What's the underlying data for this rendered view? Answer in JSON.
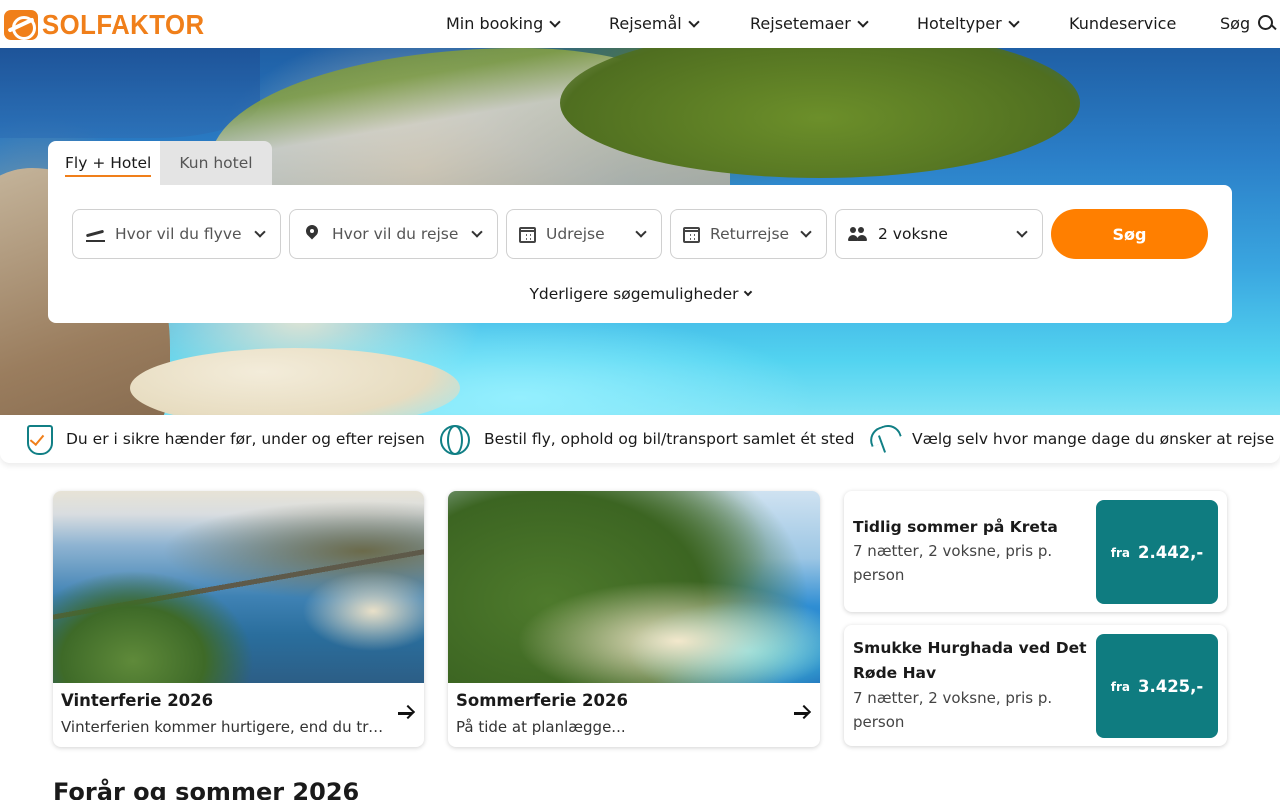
{
  "brand": {
    "name": "SOLFAKTOR",
    "color": "#f07f1a"
  },
  "nav": {
    "items": [
      {
        "label": "Min booking",
        "dropdown": true
      },
      {
        "label": "Rejsemål",
        "dropdown": true
      },
      {
        "label": "Rejsetemaer",
        "dropdown": true
      },
      {
        "label": "Hoteltyper",
        "dropdown": true
      },
      {
        "label": "Kundeservice",
        "dropdown": false
      }
    ],
    "search_label": "Søg",
    "search_icon": "search-icon"
  },
  "search": {
    "tabs": [
      {
        "label": "Fly + Hotel",
        "active": true
      },
      {
        "label": "Kun hotel",
        "active": false
      }
    ],
    "from_placeholder": "Hvor vil du flyve fra?",
    "to_placeholder": "Hvor vil du rejse hen?",
    "depart_placeholder": "Udrejse",
    "return_placeholder": "Returrejse",
    "travelers_value": "2 voksne",
    "submit_label": "Søg",
    "more_options_label": "Yderligere søgemuligheder",
    "accent_color": "#ff7f00"
  },
  "usps": [
    {
      "icon": "shield-check-icon",
      "text": "Du er i sikre hænder før, under og efter rejsen"
    },
    {
      "icon": "globe-icon",
      "text": "Bestil fly, ophold og bil/transport samlet ét sted"
    },
    {
      "icon": "beach-umbrella-icon",
      "text": "Vælg selv hvor mange dage du ønsker at rejse"
    }
  ],
  "cards": [
    {
      "title": "Vinterferie 2026",
      "subtitle": "Vinterferien kommer hurtigere, end du tror..."
    },
    {
      "title": "Sommerferie 2026",
      "subtitle": "På tide at planlægge..."
    }
  ],
  "deals": [
    {
      "title": "Tidlig sommer på Kreta",
      "subtitle": "7 nætter, 2 voksne, pris p. person",
      "price_prefix": "fra",
      "price": "2.442,-"
    },
    {
      "title": "Smukke Hurghada ved Det Røde Hav",
      "subtitle": "7 nætter, 2 voksne, pris p. person",
      "price_prefix": "fra",
      "price": "3.425,-"
    }
  ],
  "deal_color": "#0f7c80",
  "section": {
    "title": "Forår og sommer 2026"
  }
}
